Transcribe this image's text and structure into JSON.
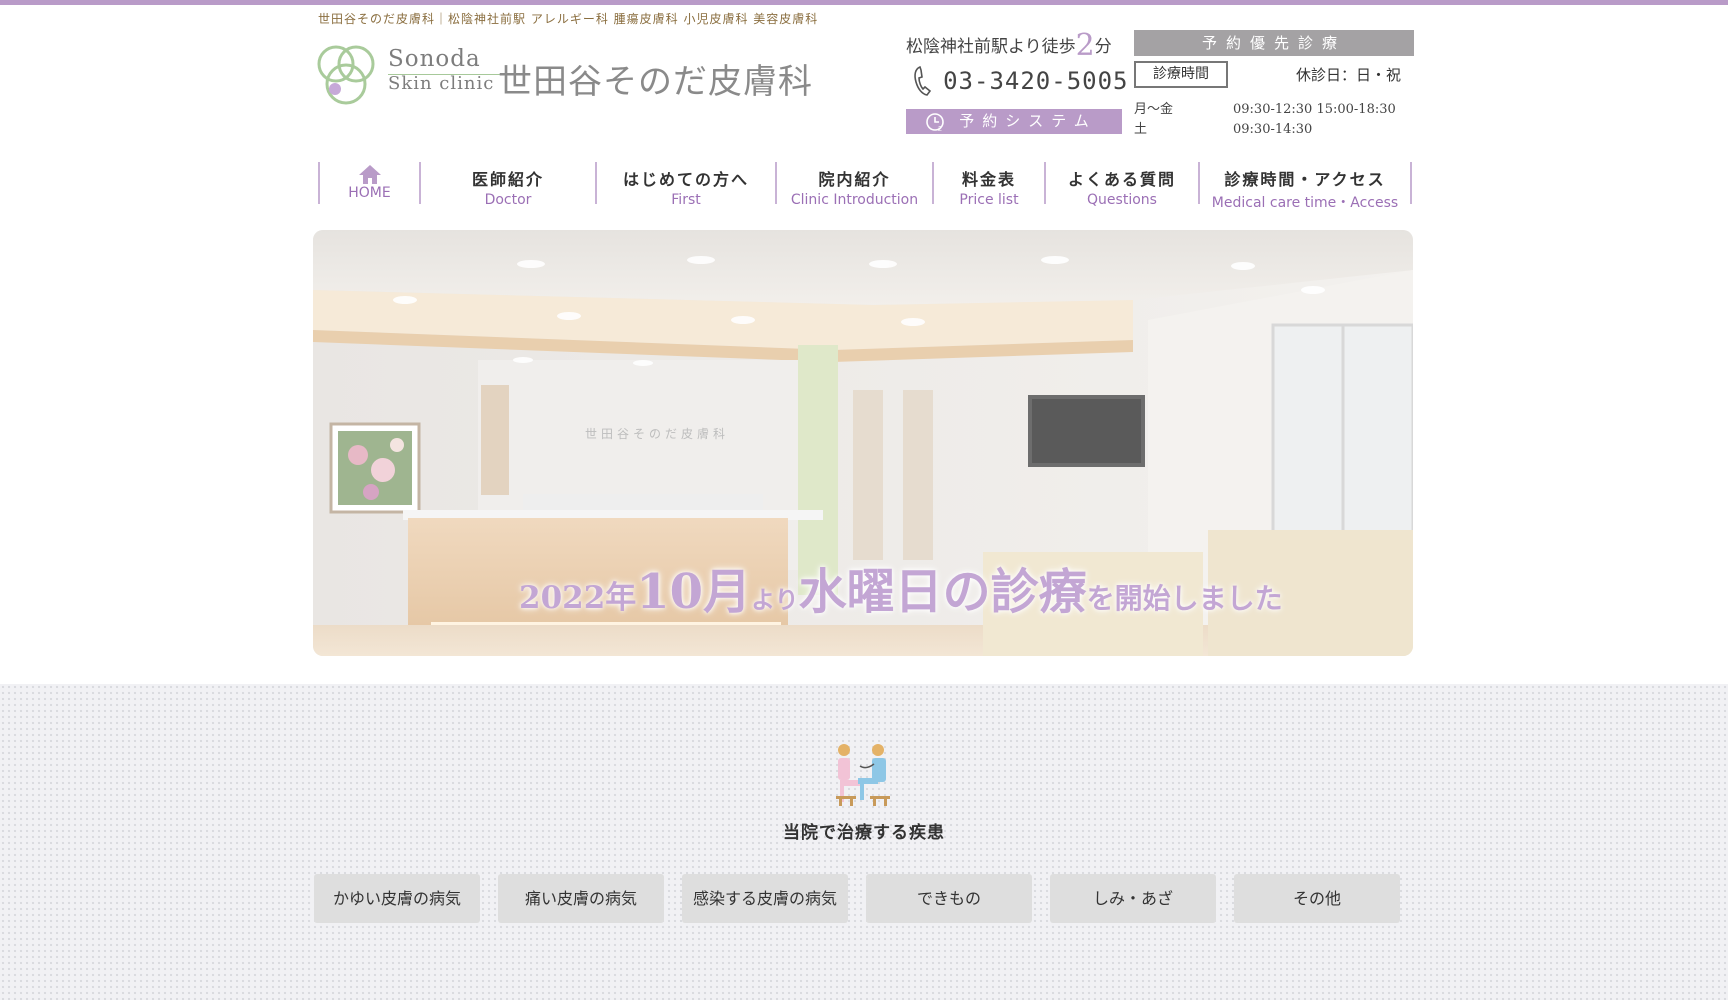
{
  "header": {
    "tagline": "世田谷そのだ皮膚科｜松陰神社前駅 アレルギー科 腫瘍皮膚科 小児皮膚科 美容皮膚科",
    "logo": {
      "name_en_1": "Sonoda",
      "name_en_2": "Skin clinic",
      "name_jp": "世田谷そのだ皮膚科"
    },
    "access_prefix": "松陰神社前駅より徒歩",
    "access_minutes": "2",
    "access_suffix": "分",
    "phone": "03-3420-5005",
    "booking_button": "予約システム",
    "priority_badge": "予約優先診療",
    "hours_tag": "診療時間",
    "closed_days": "休診日：日・祝",
    "hours": [
      {
        "days": "月～金",
        "time": "09:30-12:30 15:00-18:30"
      },
      {
        "days": "土",
        "time": "09:30-14:30"
      }
    ]
  },
  "nav": [
    {
      "jp": "",
      "en": "HOME",
      "icon": "home-icon"
    },
    {
      "jp": "医師紹介",
      "en": "Doctor"
    },
    {
      "jp": "はじめての方へ",
      "en": "First"
    },
    {
      "jp": "院内紹介",
      "en": "Clinic Introduction"
    },
    {
      "jp": "料金表",
      "en": "Price list"
    },
    {
      "jp": "よくある質問",
      "en": "Questions"
    },
    {
      "jp": "診療時間・アクセス",
      "en": "Medical care time・Access"
    }
  ],
  "hero": {
    "sign_text": "世田谷そのだ皮膚科",
    "banner": {
      "part1": "2022年",
      "part2": "10月",
      "part3": "より",
      "part4": "水曜日の診療",
      "part5": "を開始しました"
    }
  },
  "treatment": {
    "icon": "doctor-patient-icon",
    "title": "当院で治療する疾患",
    "categories": [
      "かゆい皮膚の病気",
      "痛い皮膚の病気",
      "感染する皮膚の病気",
      "できもの",
      "しみ・あざ",
      "その他"
    ]
  },
  "colors": {
    "accent": "#b99bc8",
    "nav_en": "#9b6fb5",
    "badge_gray": "#a4a2a4"
  }
}
